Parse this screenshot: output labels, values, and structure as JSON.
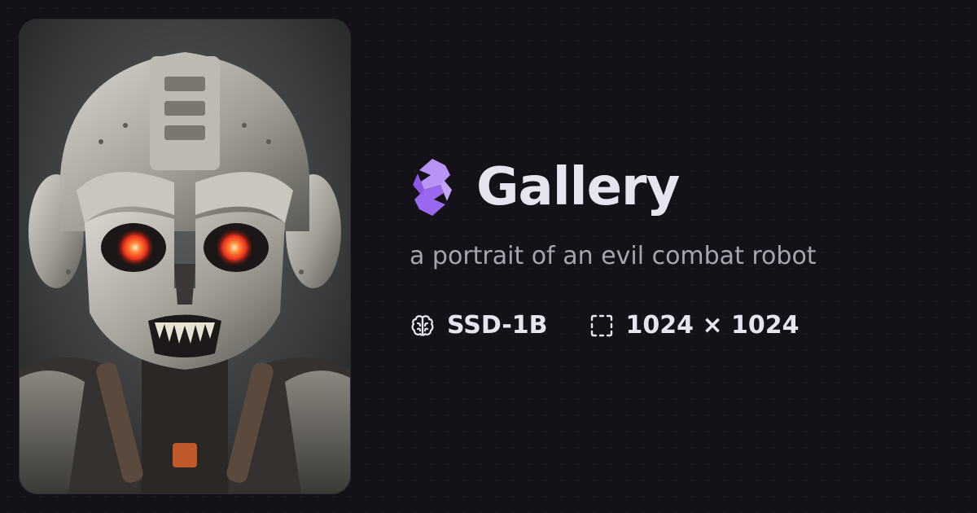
{
  "header": {
    "logo_icon": "gallery-logo-icon",
    "title": "Gallery"
  },
  "image": {
    "prompt": "a portrait of an evil combat robot"
  },
  "meta": {
    "model": {
      "icon": "brain-icon",
      "label": "SSD-1B"
    },
    "size": {
      "icon": "dashed-frame-icon",
      "label": "1024 × 1024"
    }
  },
  "colors": {
    "background": "#141218",
    "title": "#e7e3ef",
    "prompt": "#a8a4b0",
    "accent": "#a575f2",
    "robot_eye": "#ff4a2a"
  }
}
